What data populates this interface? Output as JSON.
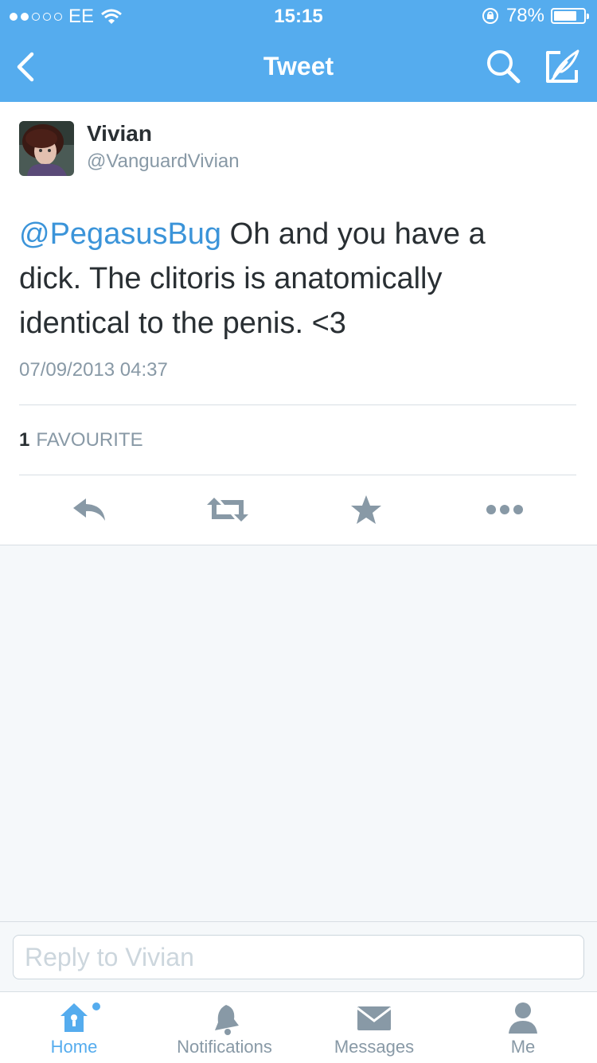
{
  "colors": {
    "brand": "#55acee",
    "mention": "#3b94d9",
    "secondary_text": "#8899a6",
    "primary_text": "#292f33"
  },
  "status_bar": {
    "carrier": "EE",
    "time": "15:15",
    "battery_percent": "78%",
    "battery_level": 0.78,
    "signal_bars_filled": 2
  },
  "nav": {
    "title": "Tweet",
    "icons": [
      "chevron-left-icon",
      "search-icon",
      "compose-icon"
    ]
  },
  "tweet": {
    "author": {
      "name": "Vivian",
      "handle": "@VanguardVivian"
    },
    "mention": "@PegasusBug",
    "text_line1": " Oh and you have a",
    "text_line2": "dick. The clitoris is anatomically",
    "text_line3": "identical to the penis. <3",
    "timestamp": "07/09/2013 04:37",
    "favourites": {
      "count": "1",
      "label": "FAVOURITE"
    },
    "actions": [
      "reply-icon",
      "retweet-icon",
      "favourite-icon",
      "more-icon"
    ]
  },
  "reply": {
    "placeholder": "Reply to Vivian"
  },
  "tabs": [
    {
      "label": "Home",
      "icon": "home-icon",
      "active": true
    },
    {
      "label": "Notifications",
      "icon": "bell-icon",
      "active": false
    },
    {
      "label": "Messages",
      "icon": "envelope-icon",
      "active": false
    },
    {
      "label": "Me",
      "icon": "person-icon",
      "active": false
    }
  ]
}
